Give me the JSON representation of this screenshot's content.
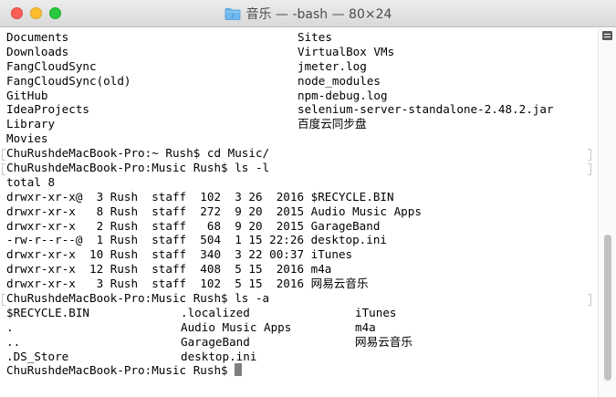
{
  "window": {
    "title": "音乐 — -bash — 80×24",
    "icon": "folder-icon"
  },
  "terminal": {
    "lines": [
      {
        "cols": [
          "Documents",
          "Sites"
        ]
      },
      {
        "cols": [
          "Downloads",
          "VirtualBox VMs"
        ]
      },
      {
        "cols": [
          "FangCloudSync",
          "jmeter.log"
        ]
      },
      {
        "cols": [
          "FangCloudSync(old)",
          "node_modules"
        ]
      },
      {
        "cols": [
          "GitHub",
          "npm-debug.log"
        ]
      },
      {
        "cols": [
          "IdeaProjects",
          "selenium-server-standalone-2.48.2.jar"
        ]
      },
      {
        "cols": [
          "Library",
          "百度云同步盘"
        ]
      },
      {
        "cols": [
          "Movies"
        ]
      },
      {
        "text": "ChuRushdeMacBook-Pro:~ Rush$ cd Music/",
        "mark": true
      },
      {
        "text": "ChuRushdeMacBook-Pro:Music Rush$ ls -l",
        "mark": true
      },
      {
        "text": "total 8"
      },
      {
        "text": "drwxr-xr-x@  3 Rush  staff  102  3 26  2016 $RECYCLE.BIN"
      },
      {
        "text": "drwxr-xr-x   8 Rush  staff  272  9 20  2015 Audio Music Apps"
      },
      {
        "text": "drwxr-xr-x   2 Rush  staff   68  9 20  2015 GarageBand"
      },
      {
        "text": "-rw-r--r--@  1 Rush  staff  504  1 15 22:26 desktop.ini"
      },
      {
        "text": "drwxr-xr-x  10 Rush  staff  340  3 22 00:37 iTunes"
      },
      {
        "text": "drwxr-xr-x  12 Rush  staff  408  5 15  2016 m4a"
      },
      {
        "text": "drwxr-xr-x   3 Rush  staff  102  5 15  2016 网易云音乐"
      },
      {
        "text": "ChuRushdeMacBook-Pro:Music Rush$ ls -a",
        "mark": true
      },
      {
        "cols3": [
          "$RECYCLE.BIN",
          ".localized",
          "iTunes"
        ]
      },
      {
        "cols3": [
          ".",
          "Audio Music Apps",
          "m4a"
        ]
      },
      {
        "cols3": [
          "..",
          "GarageBand",
          "网易云音乐"
        ]
      },
      {
        "cols3": [
          ".DS_Store",
          "desktop.ini",
          ""
        ]
      },
      {
        "text": "ChuRushdeMacBook-Pro:Music Rush$ ",
        "cursor": true
      }
    ]
  }
}
